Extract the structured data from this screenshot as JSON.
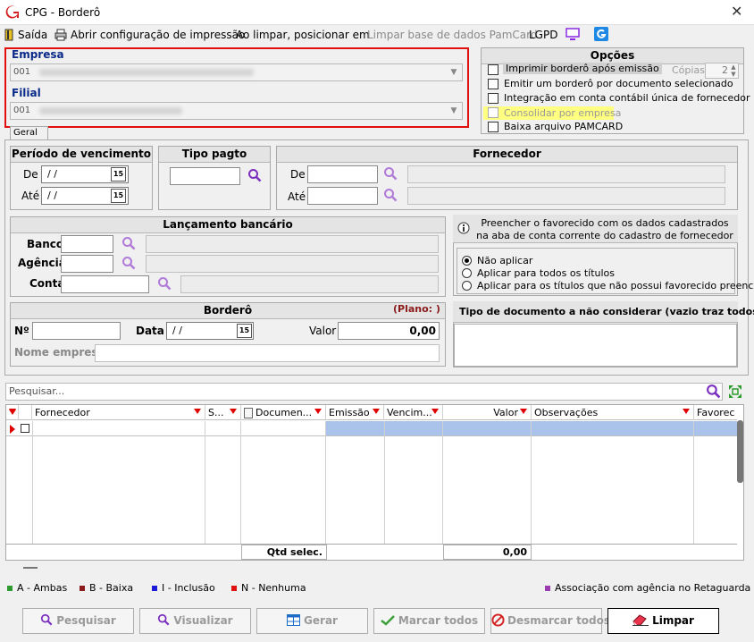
{
  "window": {
    "title": "CPG - Borderô",
    "close": "✕"
  },
  "menu": {
    "exit": "Saída",
    "print_config": "Abrir configuração de impressão",
    "clear_position": "Ao limpar, posicionar em",
    "clear_pamcard": "Limpar base de dados PamCard",
    "lgpd": "LGPD"
  },
  "empresa": {
    "label": "Empresa",
    "value": "001"
  },
  "filial": {
    "label": "Filial",
    "value": "001"
  },
  "tabs": {
    "geral": "Geral"
  },
  "opcoes": {
    "title": "Opções",
    "items": [
      {
        "label": "Imprimir borderô após emissão",
        "checked": false
      },
      {
        "label": "Emitir um borderô por documento selecionado",
        "checked": false
      },
      {
        "label": "Integração em conta contábil única de fornecedor",
        "checked": false
      },
      {
        "label": "Consolidar por empresa",
        "checked": false
      },
      {
        "label": "Baixa arquivo PAMCARD",
        "checked": false
      }
    ],
    "copias_label": "Cópias",
    "copias_value": "2"
  },
  "periodo": {
    "title": "Período de vencimento",
    "de": "De",
    "ate": "Até",
    "de_value": " /  /",
    "ate_value": " /  /",
    "cal": "15"
  },
  "tipo_pagto": {
    "title": "Tipo pagto"
  },
  "fornecedor": {
    "title": "Fornecedor",
    "de": "De",
    "ate": "Até"
  },
  "lancamento": {
    "title": "Lançamento bancário",
    "banco": "Banco",
    "agencia": "Agência",
    "conta": "Conta"
  },
  "favorecido": {
    "title": "Preencher o favorecido com os dados cadastrados na aba de conta corrente do cadastro de fornecedor",
    "options": [
      "Não aplicar",
      "Aplicar para todos os títulos",
      "Aplicar para os títulos que não possui favorecido preenchido"
    ],
    "selected": 0
  },
  "bordero": {
    "title": "Borderô",
    "plano": "(Plano:  )",
    "n": "Nº",
    "data": "Data",
    "data_value": " /  /",
    "valor": "Valor",
    "valor_value": "0,00",
    "nome_empresa": "Nome empresa"
  },
  "tipo_doc": {
    "title": "Tipo de documento a não considerar (vazio traz todos)"
  },
  "search": {
    "placeholder": "Pesquisar..."
  },
  "grid": {
    "columns": [
      "S...",
      "Fornecedor",
      "Documen...",
      "Emissão",
      "Vencim...",
      "Valor",
      "Observações",
      "Favorec"
    ],
    "footer_label": "Qtd selec.",
    "footer_total": "0,00"
  },
  "legend": {
    "ambas": "A - Ambas",
    "baixa": "B - Baixa",
    "inclusao": "I - Inclusão",
    "nenhuma": "N - Nenhuma",
    "assoc": "Associação com agência no Retaguarda",
    "colors": {
      "ambas": "#2e9b2e",
      "baixa": "#8b1a1a",
      "inclusao": "#1c1cd8",
      "nenhuma": "#e01010",
      "assoc": "#9b3bb0"
    }
  },
  "buttons": {
    "pesquisar": "Pesquisar",
    "visualizar": "Visualizar",
    "gerar": "Gerar",
    "marcar": "Marcar todos",
    "desmarcar": "Desmarcar todos",
    "limpar": "Limpar"
  }
}
